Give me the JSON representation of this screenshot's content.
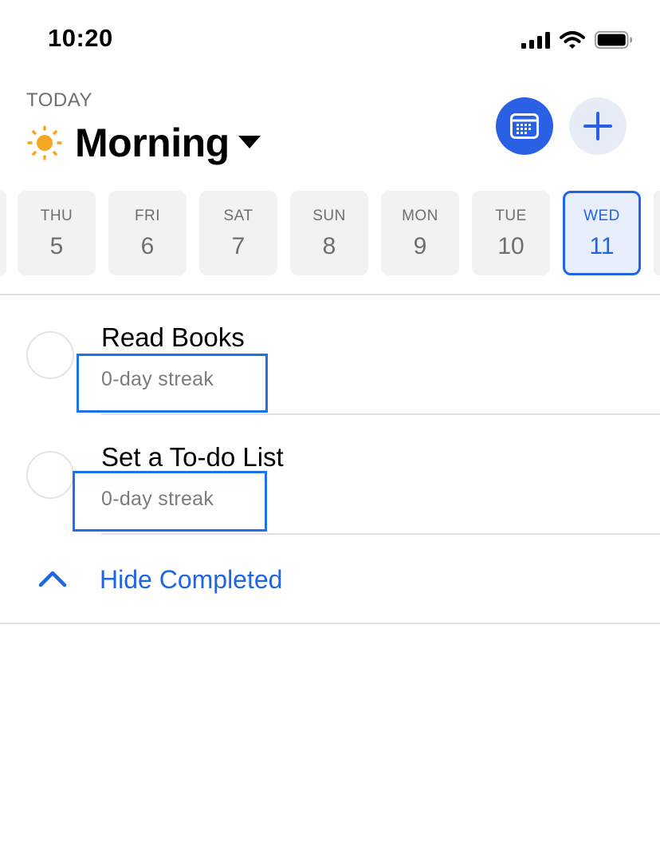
{
  "status_bar": {
    "time": "10:20",
    "icons": [
      "cellular-signal-icon",
      "wifi-icon",
      "battery-icon"
    ]
  },
  "header": {
    "today_label": "TODAY",
    "period_icon": "sun-icon",
    "period_title": "Morning",
    "dropdown_icon": "caret-down-icon",
    "calendar_button_icon": "calendar-icon",
    "add_button_icon": "plus-icon"
  },
  "week": {
    "days": [
      {
        "dow": "THU",
        "num": "5"
      },
      {
        "dow": "FRI",
        "num": "6"
      },
      {
        "dow": "SAT",
        "num": "7"
      },
      {
        "dow": "SUN",
        "num": "8"
      },
      {
        "dow": "MON",
        "num": "9"
      },
      {
        "dow": "TUE",
        "num": "10"
      },
      {
        "dow": "WED",
        "num": "11"
      }
    ],
    "selected_index": 6
  },
  "habits": [
    {
      "name": "Read Books",
      "streak": "0-day streak"
    },
    {
      "name": "Set a To-do List",
      "streak": "0-day streak"
    }
  ],
  "hide_completed": {
    "label": "Hide Completed",
    "icon": "chevron-up-icon"
  },
  "colors": {
    "accent": "#1f66e5",
    "calendar_button": "#2a60e4",
    "add_button_bg": "#e7ecf7",
    "sun": "#f5a623",
    "highlight": "#1a73e8"
  }
}
